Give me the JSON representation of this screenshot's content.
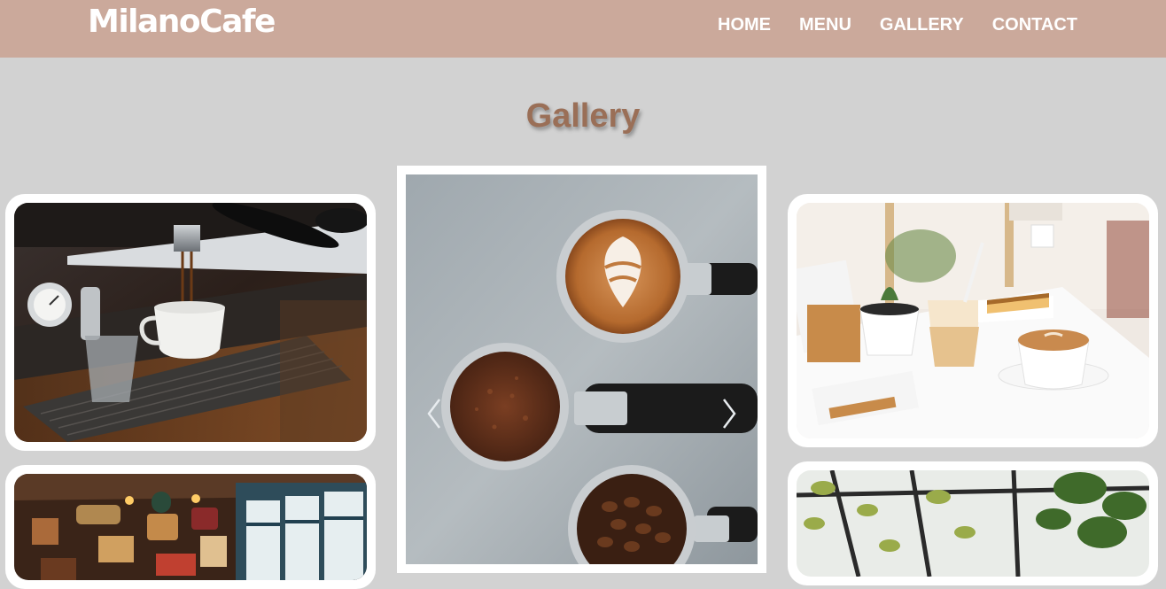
{
  "header": {
    "logo": "MilanoCafe",
    "nav": [
      {
        "label": "HOME"
      },
      {
        "label": "MENU"
      },
      {
        "label": "GALLERY"
      },
      {
        "label": "CONTACT"
      }
    ]
  },
  "gallery": {
    "title": "Gallery",
    "slider_prev_icon": "chevron-left-icon",
    "slider_next_icon": "chevron-right-icon"
  },
  "colors": {
    "navbar": "#cba99b",
    "background": "#d2d2d2",
    "title": "#9a6f57"
  }
}
